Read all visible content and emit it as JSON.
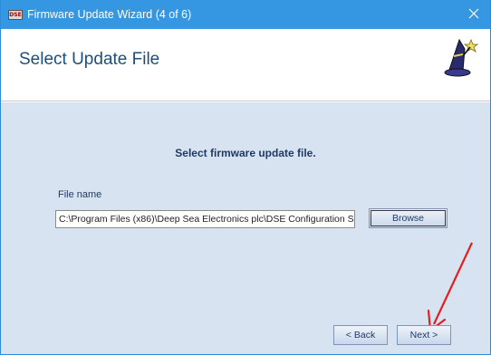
{
  "window": {
    "title": "Firmware Update Wizard (4 of 6)",
    "app_icon_text": "DSE"
  },
  "header": {
    "title": "Select Update File"
  },
  "main": {
    "instruction": "Select firmware update file.",
    "file_label": "File name",
    "file_path": "C:\\Program Files (x86)\\Deep Sea Electronics plc\\DSE Configuration S",
    "browse_label": "Browse"
  },
  "footer": {
    "back_label": "< Back",
    "next_label": "Next >"
  },
  "colors": {
    "titlebar": "#3597e1",
    "body_bg": "#d8e3f2",
    "heading": "#1f4e79",
    "annotation_arrow": "#e02020"
  },
  "icons": [
    "app-icon",
    "close-icon",
    "wizard-icon",
    "annotation-arrow"
  ]
}
